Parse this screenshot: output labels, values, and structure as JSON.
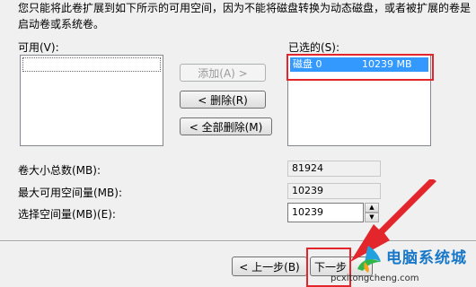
{
  "description": "您只能将此卷扩展到如下所示的可用空间，因为不能将磁盘转换为动态磁盘，或者被扩展的卷是启动卷或系统卷。",
  "available": {
    "label": "可用(V):"
  },
  "selected": {
    "label": "已选的(S):",
    "items": [
      {
        "name": "磁盘 0",
        "size": "10239 MB"
      }
    ]
  },
  "buttons": {
    "add": "添加(A) >",
    "remove": "< 删除(R)",
    "remove_all": "< 全部删除(M)",
    "back": "< 上一步(B)",
    "next": "下一步"
  },
  "fields": {
    "total_label": "卷大小总数(MB):",
    "total_value": "81924",
    "max_label": "最大可用空间量(MB):",
    "max_value": "10239",
    "select_label": "选择空间量(MB)(E):",
    "select_value": "10239"
  },
  "watermark": {
    "title": "电脑系统城",
    "url": "pcxitongcheng.com"
  },
  "colors": {
    "highlight": "#3399ff",
    "annotation": "#e2262b"
  }
}
